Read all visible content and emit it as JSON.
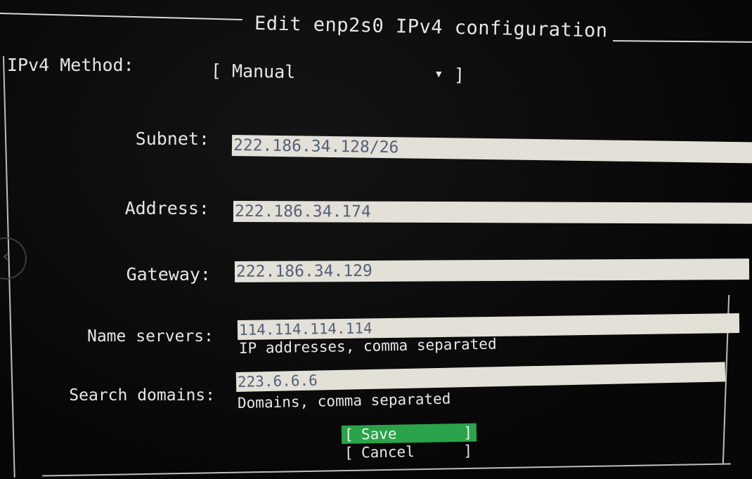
{
  "dialog": {
    "title": "Edit enp2s0 IPv4 configuration"
  },
  "method": {
    "label": "IPv4 Method:",
    "open": "[",
    "value": "Manual",
    "arrow": "▼",
    "close": "]"
  },
  "fields": {
    "subnet": {
      "label": "Subnet:",
      "value": "222.186.34.128/26"
    },
    "address": {
      "label": "Address:",
      "value": "222.186.34.174"
    },
    "gateway": {
      "label": "Gateway:",
      "value": "222.186.34.129"
    },
    "name_servers": {
      "label": "Name servers:",
      "value": "114.114.114.114",
      "hint": "IP addresses, comma separated"
    },
    "search_domains": {
      "label": "Search domains:",
      "value": "223.6.6.6",
      "hint": "Domains, comma separated"
    }
  },
  "buttons": {
    "open": "[",
    "close": "]",
    "save": "Save",
    "cancel": "Cancel"
  },
  "nav": {
    "back_glyph": "‹"
  },
  "colors": {
    "background": "#0b0b0b",
    "field_bg": "#e3e0d8",
    "field_text": "#556078",
    "save_bg": "#2aa34a"
  }
}
